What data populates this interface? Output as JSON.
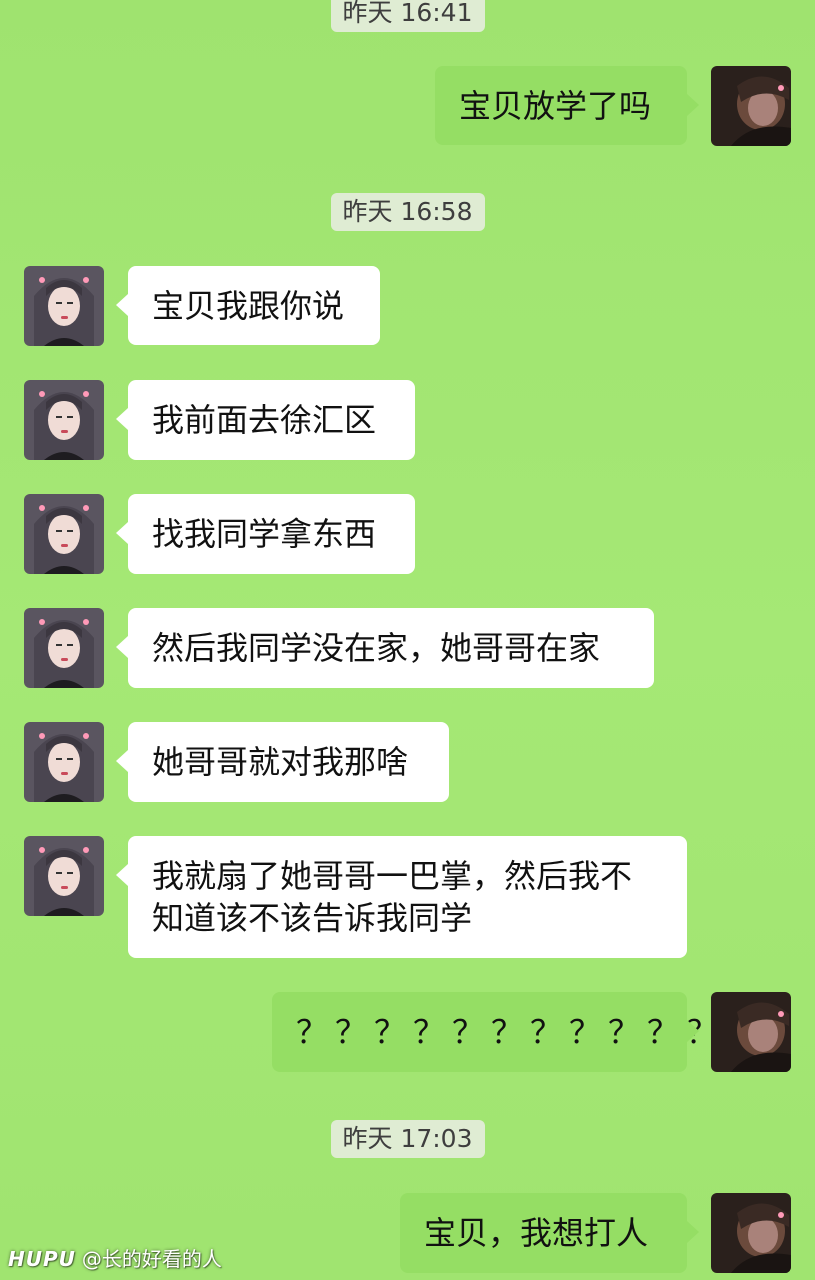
{
  "timestamps": [
    "昨天 16:41",
    "昨天 16:58",
    "昨天 17:03"
  ],
  "messages": [
    {
      "sender": "me",
      "text": "宝贝放学了吗"
    },
    {
      "sender": "her",
      "text": "宝贝我跟你说"
    },
    {
      "sender": "her",
      "text": "我前面去徐汇区"
    },
    {
      "sender": "her",
      "text": "找我同学拿东西"
    },
    {
      "sender": "her",
      "text": "然后我同学没在家，她哥哥在家"
    },
    {
      "sender": "her",
      "text": "她哥哥就对我那啥"
    },
    {
      "sender": "her",
      "lines": [
        "我就扇了她哥哥一巴掌，然后我不",
        "知道该不该告诉我同学"
      ]
    },
    {
      "sender": "me",
      "text": "？？？？？？？？？？？"
    },
    {
      "sender": "me",
      "text": "宝贝，我想打人"
    }
  ],
  "watermark": {
    "logo": "HUPU",
    "user": "@长的好看的人"
  },
  "colors": {
    "background": "#a3e673",
    "outgoing_bubble": "#95de64",
    "incoming_bubble": "#ffffff",
    "timestamp_bg": "#dfecd3"
  },
  "icons": {
    "my_avatar": "avatar-photo-dark",
    "her_avatar": "avatar-photo-girl"
  }
}
